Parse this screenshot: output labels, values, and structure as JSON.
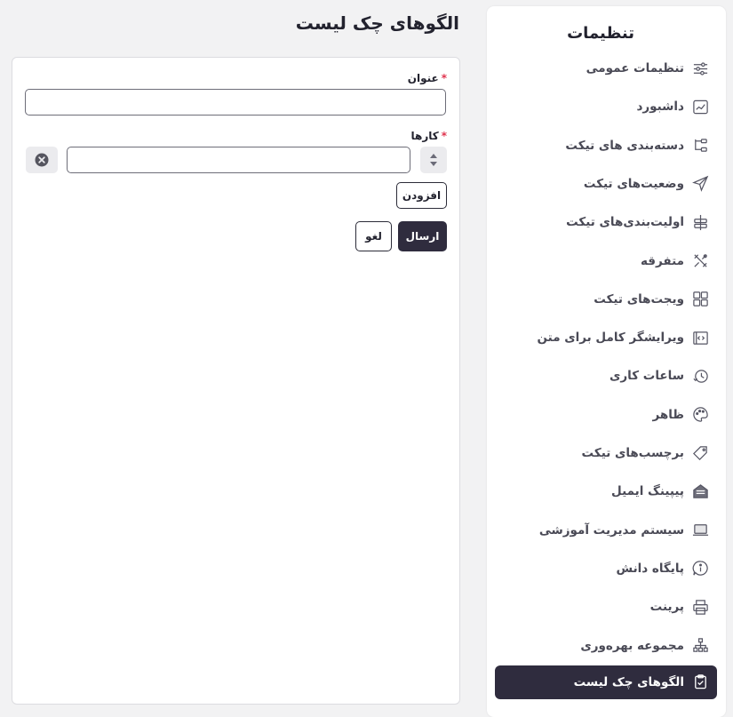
{
  "sidebar": {
    "title": "تنظیمات",
    "items": [
      {
        "label": "تنظیمات عمومی",
        "icon": "sliders-icon",
        "active": false
      },
      {
        "label": "داشبورد",
        "icon": "dashboard-chart-icon",
        "active": false
      },
      {
        "label": "دسته‌بندی های تیکت",
        "icon": "category-tree-icon",
        "active": false
      },
      {
        "label": "وضعیت‌های تیکت",
        "icon": "send-arrow-icon",
        "active": false
      },
      {
        "label": "اولیت‌بندی‌های تیکت",
        "icon": "priority-layers-icon",
        "active": false
      },
      {
        "label": "متفرقه",
        "icon": "tools-icon",
        "active": false
      },
      {
        "label": "ویجت‌های تیکت",
        "icon": "widgets-grid-icon",
        "active": false
      },
      {
        "label": "ویرایشگر کامل برای متن",
        "icon": "code-editor-icon",
        "active": false
      },
      {
        "label": "ساعات کاری",
        "icon": "clock-icon",
        "active": false
      },
      {
        "label": "ظاهر",
        "icon": "palette-icon",
        "active": false
      },
      {
        "label": "برچسب‌های تیکت",
        "icon": "tag-icon",
        "active": false
      },
      {
        "label": "پیپینگ ایمیل",
        "icon": "email-piping-icon",
        "active": false
      },
      {
        "label": "سیستم مدیریت آموزشی",
        "icon": "laptop-icon",
        "active": false
      },
      {
        "label": "پایگاه دانش",
        "icon": "info-bubble-icon",
        "active": false
      },
      {
        "label": "پرینت",
        "icon": "printer-icon",
        "active": false
      },
      {
        "label": "مجموعه بهره‌وری",
        "icon": "hierarchy-icon",
        "active": false
      },
      {
        "label": "الگوهای چک لیست",
        "icon": "clipboard-check-icon",
        "active": true
      }
    ]
  },
  "page": {
    "title": "الگوهای چک لیست"
  },
  "form": {
    "title_label": "عنوان",
    "title_value": "",
    "tasks_label": "کارها",
    "task_value": "",
    "required_mark": "*",
    "add_button": "افزودن",
    "submit_button": "ارسال",
    "cancel_button": "لغو"
  },
  "colors": {
    "accent": "#2f2c3e",
    "required": "#e0334e",
    "background": "#f2f2f3"
  }
}
